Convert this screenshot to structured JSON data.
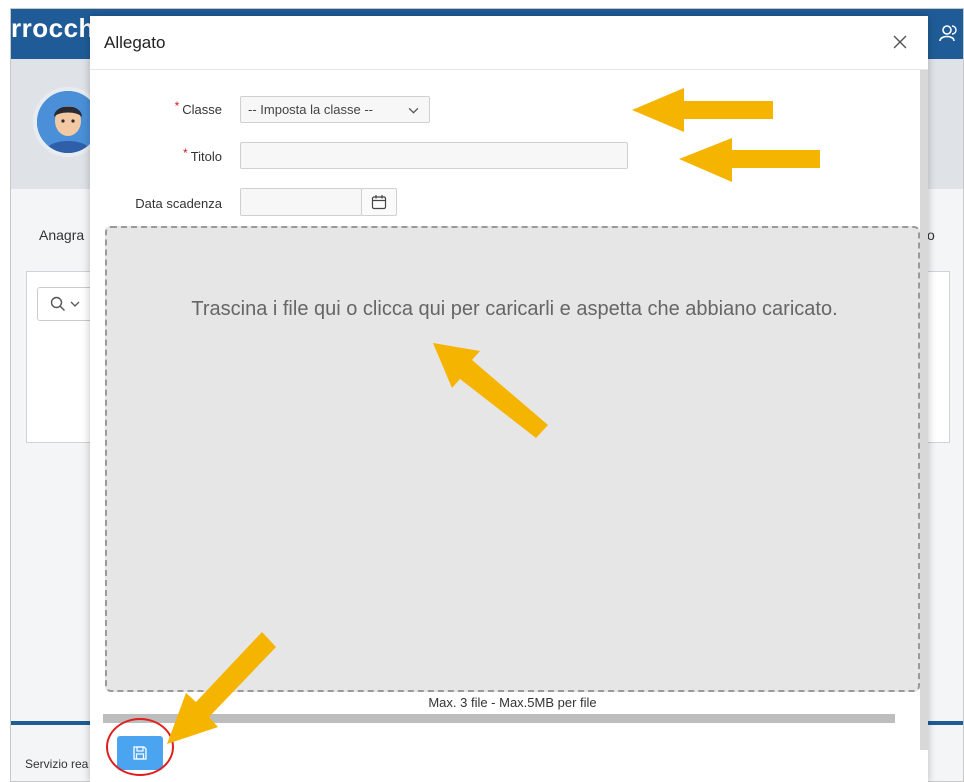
{
  "background": {
    "app_title": "rrocch",
    "tab_left": "Anagra",
    "tab_right": "o",
    "footer_text": "Servizio rea"
  },
  "modal": {
    "title": "Allegato",
    "close_label": "×",
    "fields": {
      "classe_label": "Classe",
      "classe_value": "-- Imposta la classe --",
      "titolo_label": "Titolo",
      "titolo_value": "",
      "scadenza_label": "Data scadenza",
      "scadenza_value": ""
    },
    "required_marker": "*",
    "dropzone_text": "Trascina i file qui o clicca qui per caricarli e aspetta che abbiano caricato.",
    "dropzone_limit": "Max. 3 file - Max.5MB per file"
  },
  "colors": {
    "topbar": "#1f5c97",
    "annotation_arrow": "#f5b400",
    "annotation_circle": "#e02020",
    "save_button": "#4ba4ef",
    "required": "#d01b1b"
  },
  "icons": {
    "close": "close-icon",
    "chevron": "chevron-down-icon",
    "calendar": "calendar-icon",
    "save": "floppy-disk-icon",
    "user": "users-icon",
    "search": "search-icon"
  }
}
